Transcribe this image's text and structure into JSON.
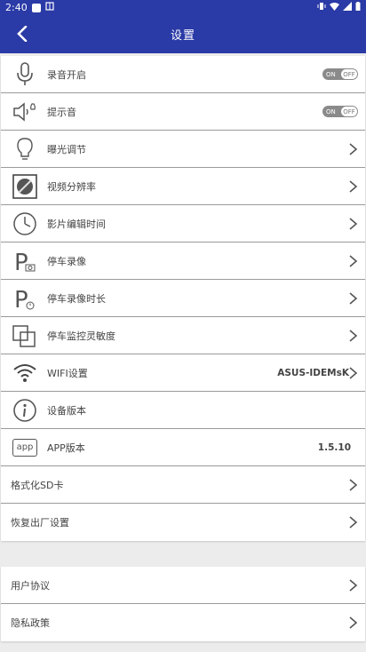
{
  "status": {
    "time": "2:40",
    "carrier_icon": "sim-icon"
  },
  "header": {
    "title": "设置"
  },
  "main": {
    "items": [
      {
        "label": "录音开启",
        "control": "toggle",
        "toggle_on_text": "ON",
        "toggle_off_text": "OFF"
      },
      {
        "label": "提示音",
        "control": "toggle",
        "toggle_on_text": "ON",
        "toggle_off_text": "OFF"
      },
      {
        "label": "曝光调节",
        "control": "chevron"
      },
      {
        "label": "视频分辨率",
        "control": "chevron"
      },
      {
        "label": "影片编辑时间",
        "control": "chevron"
      },
      {
        "label": "停车录像",
        "control": "chevron"
      },
      {
        "label": "停车录像时长",
        "control": "chevron"
      },
      {
        "label": "停车监控灵敏度",
        "control": "chevron"
      },
      {
        "label": "WIFI设置",
        "value": "ASUS-IDEMsK",
        "control": "chevron"
      },
      {
        "label": "设备版本",
        "control": "none"
      },
      {
        "label": "APP版本",
        "value": "1.5.10",
        "control": "none",
        "icon_text": "app"
      },
      {
        "label": "格式化SD卡",
        "control": "chevron"
      },
      {
        "label": "恢复出厂设置",
        "control": "chevron"
      }
    ]
  },
  "legal": {
    "items": [
      {
        "label": "用户协议"
      },
      {
        "label": "隐私政策"
      }
    ]
  }
}
